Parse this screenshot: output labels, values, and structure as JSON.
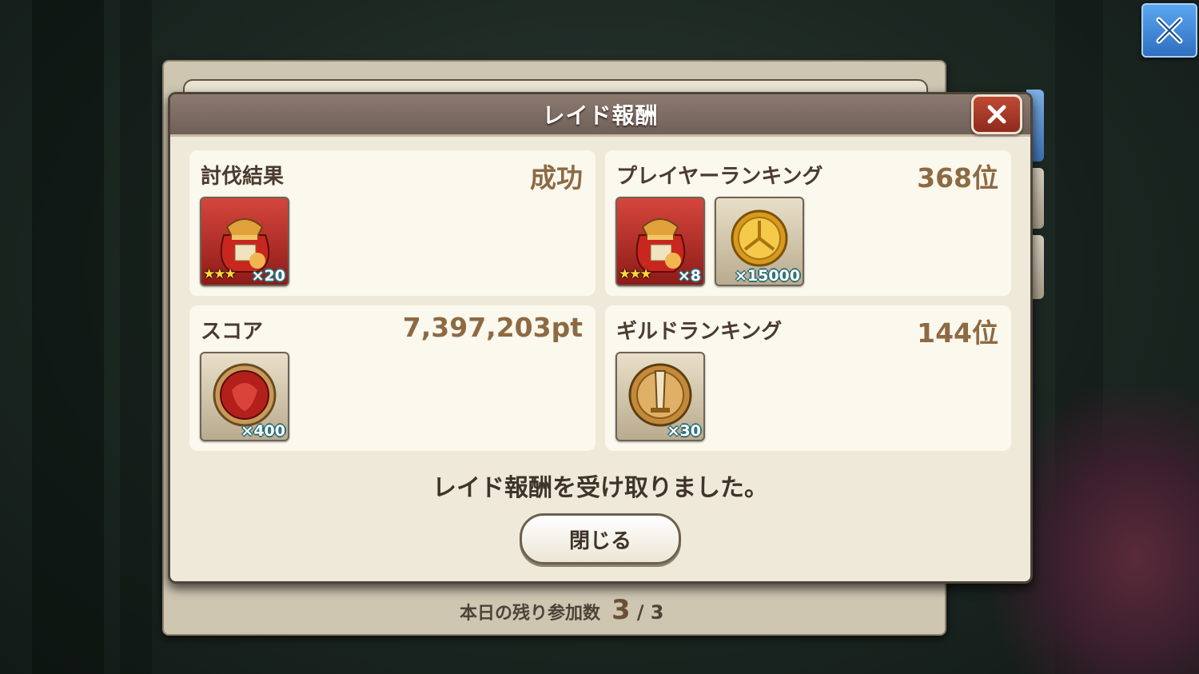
{
  "dialog": {
    "title": "レイド報酬",
    "message": "レイド報酬を受け取りました。",
    "close_label": "閉じる"
  },
  "result_card": {
    "label": "討伐結果",
    "value": "成功",
    "items": [
      {
        "icon": "treasure-bag-icon",
        "stars": "★★★",
        "qty": "×20"
      }
    ]
  },
  "player_ranking_card": {
    "label": "プレイヤーランキング",
    "value": "368位",
    "items": [
      {
        "icon": "treasure-bag-icon",
        "stars": "★★★",
        "qty": "×8"
      },
      {
        "icon": "gold-coin-icon",
        "qty": "×15000"
      }
    ]
  },
  "score_card": {
    "label": "スコア",
    "value": "7,397,203pt",
    "items": [
      {
        "icon": "red-gem-medal-icon",
        "qty": "×400"
      }
    ]
  },
  "guild_ranking_card": {
    "label": "ギルドランキング",
    "value": "144位",
    "items": [
      {
        "icon": "sword-medal-icon",
        "qty": "×30"
      }
    ]
  },
  "footer": {
    "remaining_label": "本日の残り参加数",
    "remaining_current": "3",
    "remaining_total": "/ 3"
  },
  "colors": {
    "header": "#7c6c64",
    "panel": "#efe9d9",
    "card": "#fbf8ed",
    "value_text": "#8d6a44",
    "close_red": "#b13e2b",
    "top_close_blue": "#3f86d6"
  }
}
